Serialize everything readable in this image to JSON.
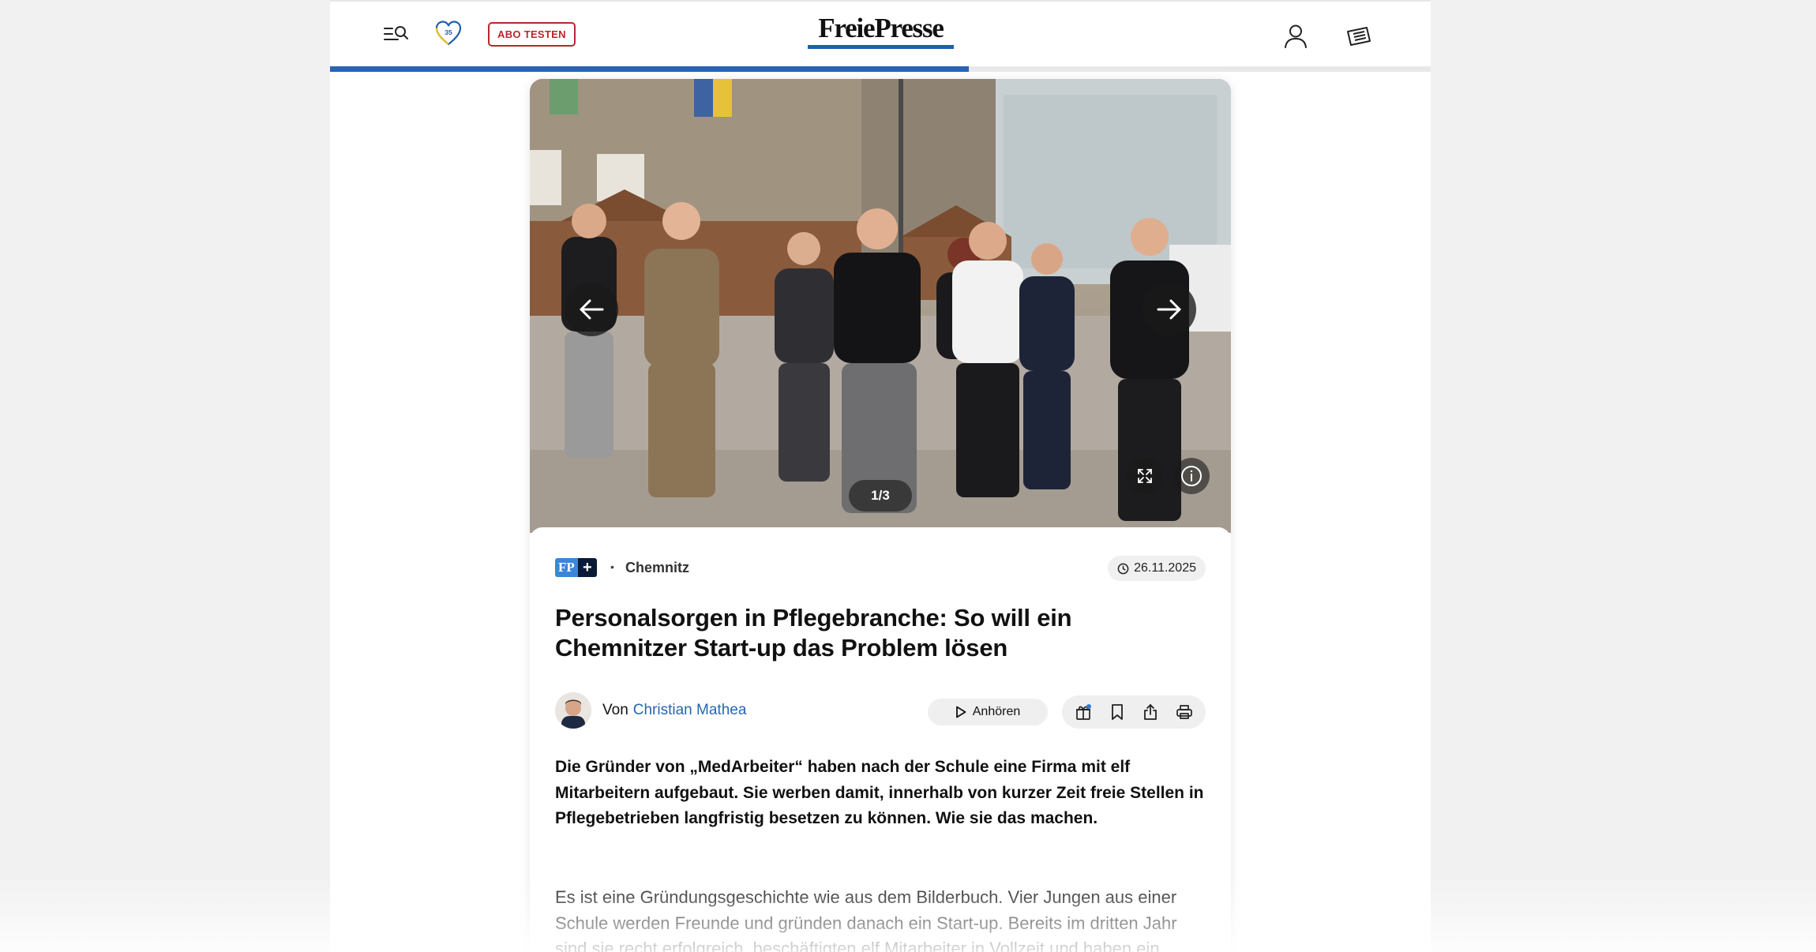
{
  "header": {
    "abo_label": "ABO TESTEN",
    "logo_text": "FreiePresse",
    "heart_badge": "35",
    "reading_progress_percent": 58,
    "colors": {
      "brand_blue": "#1f5fae",
      "abo_red": "#b8272b",
      "progress": "#2764b5"
    },
    "icons": [
      "menu-search-icon",
      "heart-icon",
      "user-icon",
      "epaper-icon"
    ]
  },
  "gallery": {
    "counter": "1/3",
    "icons": [
      "arrow-left-icon",
      "arrow-right-icon",
      "fullscreen-icon",
      "info-icon"
    ]
  },
  "article": {
    "badge_fp": "FP",
    "badge_plus": "+",
    "category": "Chemnitz",
    "date": "26.11.2025",
    "headline": "Personalsorgen in Pflegebranche: So will ein Chemnitzer Start-up das Problem lösen",
    "author_prefix": "Von",
    "author_name": "Christian Mathea",
    "listen_label": "Anhören",
    "action_icons": [
      "gift-icon",
      "bookmark-icon",
      "share-icon",
      "print-icon"
    ],
    "lead": "Die Gründer von „MedArbeiter“ haben nach der Schule eine Firma mit elf Mitarbeitern aufgebaut. Sie werben damit, innerhalb von kurzer Zeit freie Stellen in Pflegebetrieben langfristig besetzen zu können. Wie sie das machen.",
    "body": "Es ist eine Gründungsgeschichte wie aus dem Bilderbuch. Vier Jungen aus einer Schule werden Freunde und gründen danach ein Start-up. Bereits im dritten Jahr sind sie recht erfolgreich, beschäftigten elf Mitarbeiter in Vollzeit und haben ein"
  }
}
